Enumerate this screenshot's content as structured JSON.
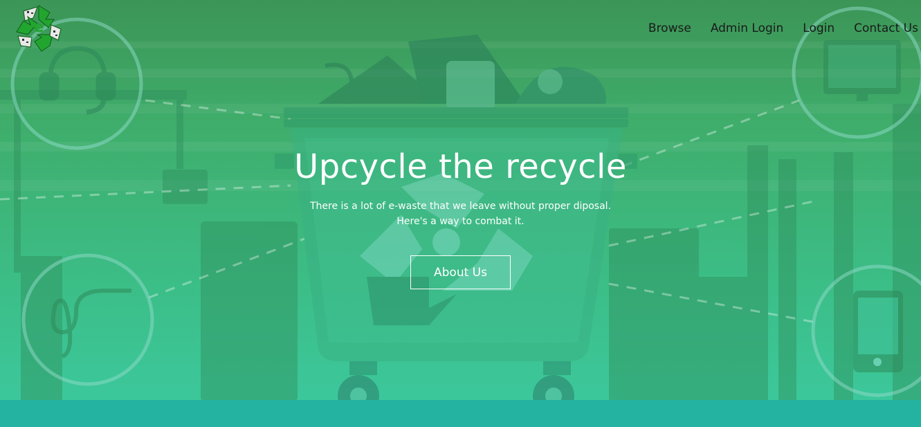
{
  "nav": {
    "items": [
      {
        "label": "Browse"
      },
      {
        "label": "Admin Login"
      },
      {
        "label": "Login"
      },
      {
        "label": "Contact Us"
      }
    ]
  },
  "hero": {
    "title": "Upcycle the recycle",
    "subtitle_line1": "There is a lot of e-waste that we leave without proper diposal.",
    "subtitle_line2": "Here's a way to combat it.",
    "button_label": "About Us"
  },
  "logo": {
    "letter": "e",
    "icon": "recycle-logo-icon"
  },
  "colors": {
    "bg_top": "#3c9556",
    "bg_bottom": "#3ccaa0",
    "footer": "#23b3a0",
    "text_light": "#ffffff",
    "nav_text": "#1a1a1a"
  }
}
